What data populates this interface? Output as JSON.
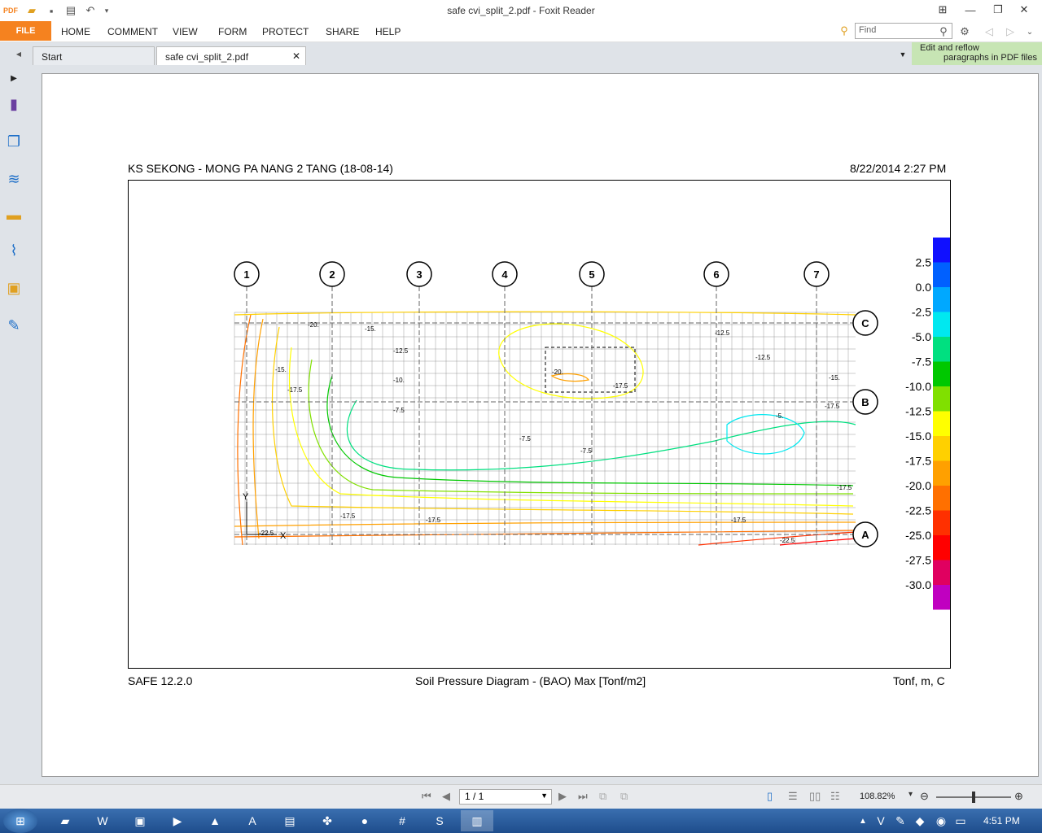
{
  "window": {
    "title": "safe cvi_split_2.pdf - Foxit Reader"
  },
  "menu": {
    "file": "FILE",
    "items": [
      "HOME",
      "COMMENT",
      "VIEW",
      "FORM",
      "PROTECT",
      "SHARE",
      "HELP"
    ],
    "find_placeholder": "Find"
  },
  "tabs": [
    {
      "label": "Start"
    },
    {
      "label": "safe cvi_split_2.pdf"
    }
  ],
  "tip": {
    "line1": "Edit and reflow",
    "line2": "paragraphs in PDF files"
  },
  "document": {
    "header_left": "KS SEKONG - MONG PA NANG 2 TANG (18-08-14)",
    "header_right": "8/22/2014 2:27 PM",
    "footer_left": "SAFE 12.2.0",
    "footer_center": "Soil Pressure Diagram - (BAO)  Max  [Tonf/m2]",
    "footer_right": "Tonf, m, C"
  },
  "chart_data": {
    "type": "heatmap",
    "grid_columns": [
      "1",
      "2",
      "3",
      "4",
      "5",
      "6",
      "7"
    ],
    "grid_rows": [
      "C",
      "B",
      "A"
    ],
    "axis_markers": [
      "Y",
      "X"
    ],
    "legend": {
      "values": [
        2.5,
        0.0,
        -2.5,
        -5.0,
        -7.5,
        -10.0,
        -12.5,
        -15.0,
        -17.5,
        -20.0,
        -22.5,
        -25.0,
        -27.5,
        -30.0
      ],
      "labels": [
        "2.5",
        "0.0",
        "-2.5",
        "-5.0",
        "-7.5",
        "-10.0",
        "-12.5",
        "-15.0",
        "-17.5",
        "-20.0",
        "-22.5",
        "-25.0",
        "-27.5",
        "-30.0"
      ],
      "colors": [
        "#1010ff",
        "#0060ff",
        "#00a8ff",
        "#00e8f0",
        "#00e080",
        "#00c800",
        "#80e000",
        "#ffff00",
        "#ffd000",
        "#ffa000",
        "#ff7000",
        "#ff3000",
        "#ff0000",
        "#e00060",
        "#c000c0"
      ]
    },
    "contour_labels": [
      "-22.5",
      "-20.",
      "-17.5",
      "-15.",
      "-12.5",
      "-10.",
      "-7.5",
      "-5."
    ]
  },
  "statusbar": {
    "page": "1 / 1",
    "zoom": "108.82%"
  },
  "taskbar": {
    "clock": "4:51 PM"
  }
}
